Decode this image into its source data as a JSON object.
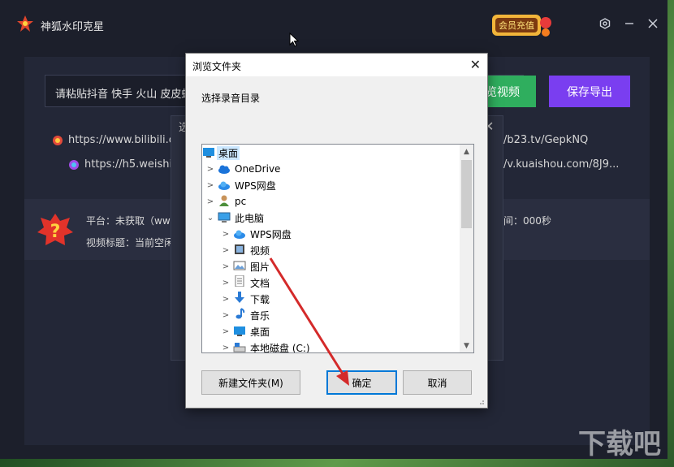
{
  "app": {
    "title": "神狐水印克星",
    "vip_banner_text": "会员充值",
    "url_input_value": "请粘贴抖音 快手 火山 皮皮虾 美",
    "parse_button": "解析视频",
    "parse_button_visible": "览视频",
    "save_button": "保存导出",
    "examples": [
      {
        "left_text": "https://www.bilibili.co",
        "right_text": "/b23.tv/GepkNQ"
      },
      {
        "left_text": "https://h5.weishi.c",
        "right_text": "/v.kuaishou.com/8J9..."
      }
    ],
    "info": {
      "platform_label": "平台：未获取（ww",
      "title_label": "视频标题：当前空闲",
      "duration_label": "间：000秒"
    },
    "bg_modal_title": "选",
    "colors": {
      "accent_green": "#2fae5e",
      "accent_purple": "#7a3ef0",
      "bg_dark": "#1c1f2b"
    }
  },
  "dialog": {
    "title": "浏览文件夹",
    "prompt": "选择录音目录",
    "tree": [
      {
        "label": "桌面",
        "icon": "desktop-icon",
        "level": 0,
        "chevron": "",
        "selected": true
      },
      {
        "label": "OneDrive",
        "icon": "cloud-icon",
        "level": 1,
        "chevron": ">"
      },
      {
        "label": "WPS网盘",
        "icon": "wps-cloud-icon",
        "level": 1,
        "chevron": ">"
      },
      {
        "label": "pc",
        "icon": "user-icon",
        "level": 1,
        "chevron": ">"
      },
      {
        "label": "此电脑",
        "icon": "computer-icon",
        "level": 1,
        "chevron": "v"
      },
      {
        "label": "WPS网盘",
        "icon": "wps-cloud-icon",
        "level": 2,
        "chevron": ">"
      },
      {
        "label": "视频",
        "icon": "video-folder-icon",
        "level": 2,
        "chevron": ">"
      },
      {
        "label": "图片",
        "icon": "picture-folder-icon",
        "level": 2,
        "chevron": ">"
      },
      {
        "label": "文档",
        "icon": "document-folder-icon",
        "level": 2,
        "chevron": ">"
      },
      {
        "label": "下载",
        "icon": "download-folder-icon",
        "level": 2,
        "chevron": ">"
      },
      {
        "label": "音乐",
        "icon": "music-folder-icon",
        "level": 2,
        "chevron": ">"
      },
      {
        "label": "桌面",
        "icon": "desktop-icon",
        "level": 2,
        "chevron": ">"
      },
      {
        "label": "本地磁盘 (C:)",
        "icon": "drive-icon",
        "level": 2,
        "chevron": ">"
      }
    ],
    "buttons": {
      "new_folder": "新建文件夹(M)",
      "ok": "确定",
      "cancel": "取消"
    }
  },
  "watermark": "下载吧"
}
